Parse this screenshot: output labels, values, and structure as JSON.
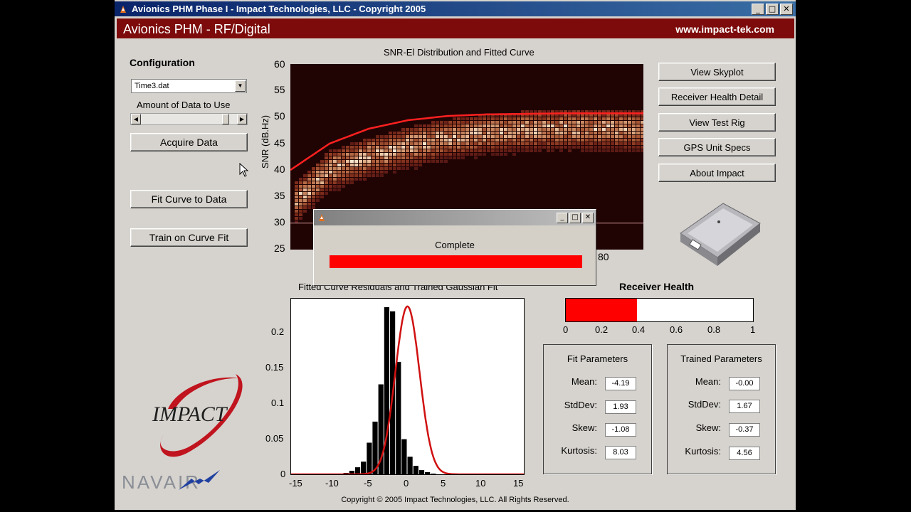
{
  "window": {
    "title": "Avionics PHM Phase I - Impact Technologies, LLC - Copyright 2005",
    "buttons": [
      "_",
      "□",
      "✕"
    ]
  },
  "banner": {
    "title": "Avionics PHM - RF/Digital",
    "url": "www.impact-tek.com"
  },
  "left_panel": {
    "config_label": "Configuration",
    "config_value": "Time3.dat",
    "amount_label": "Amount of Data to Use",
    "slider_value": 0.9,
    "acquire_label": "Acquire Data",
    "fit_label": "Fit Curve to Data",
    "train_label": "Train on Curve Fit"
  },
  "right_buttons": [
    "View Skyplot",
    "Receiver Health Detail",
    "View Test Rig",
    "GPS Unit Specs",
    "About Impact"
  ],
  "snr_chart": {
    "title": "SNR-El Distribution and Fitted Curve",
    "ylabel": "SNR (dB.Hz)",
    "yticks": [
      "60",
      "55",
      "50",
      "45",
      "40",
      "35",
      "30",
      "25"
    ],
    "xtick_visible": "80",
    "colors": {
      "background": "#200404",
      "fit": "#ff2020",
      "density": "#fff2e0"
    }
  },
  "dialog": {
    "message": "Complete",
    "progress": 1.0,
    "buttons": [
      "_",
      "□",
      "✕"
    ]
  },
  "resid_chart": {
    "title": "Fitted Curve Residuals and Trained Gaussian Fit",
    "yticks": [
      "0.2",
      "0.15",
      "0.1",
      "0.05",
      "0"
    ],
    "xticks": [
      "-15",
      "-10",
      "-5",
      "0",
      "5",
      "10",
      "15"
    ]
  },
  "chart_data": [
    {
      "type": "heatmap",
      "title": "SNR-El Distribution and Fitted Curve",
      "ylabel": "SNR (dB.Hz)",
      "ylim": [
        25,
        60
      ],
      "xlim": [
        0,
        90
      ],
      "x_tick_labels_visible": [
        "80"
      ],
      "fitted_curve": {
        "x": [
          0,
          10,
          20,
          30,
          40,
          50,
          60,
          70,
          80,
          90
        ],
        "y": [
          40,
          45,
          47.8,
          49.4,
          50.2,
          50.5,
          50.6,
          50.7,
          50.7,
          50.7
        ]
      },
      "density_band_center": {
        "x": [
          0,
          10,
          20,
          30,
          40,
          50,
          60,
          70,
          80,
          90
        ],
        "y": [
          33,
          40,
          42.5,
          44.5,
          46,
          47,
          47.5,
          47.8,
          47.8,
          47.6
        ]
      },
      "colors": {
        "fit": "#ff2020",
        "high_density": "#fff2e0",
        "background": "#200404"
      }
    },
    {
      "type": "bar",
      "title": "Fitted Curve Residuals and Trained Gaussian Fit",
      "xlim": [
        -16,
        16
      ],
      "ylim": [
        0,
        0.25
      ],
      "bin_width": 0.8,
      "bins": [
        -8.8,
        -8,
        -7.2,
        -6.4,
        -5.6,
        -4.8,
        -4,
        -3.2,
        -2.4,
        -1.6,
        -0.8,
        0,
        0.8,
        1.6,
        2.4,
        3.2
      ],
      "values": [
        0.002,
        0.005,
        0.01,
        0.018,
        0.045,
        0.075,
        0.128,
        0.238,
        0.232,
        0.16,
        0.05,
        0.025,
        0.012,
        0.006,
        0.003,
        0.001
      ],
      "gaussian": {
        "mean": 0.0,
        "std": 1.67,
        "peak": 0.239,
        "color": "#d01010"
      },
      "bar_color": "#000000"
    },
    {
      "type": "bar",
      "title": "Receiver Health",
      "value": 0.38,
      "xlim": [
        0,
        1
      ],
      "xticks": [
        "0",
        "0.2",
        "0.4",
        "0.6",
        "0.8",
        "1"
      ]
    }
  ],
  "health": {
    "title": "Receiver Health",
    "value": 0.38,
    "xticks": [
      "0",
      "0.2",
      "0.4",
      "0.6",
      "0.8",
      "1"
    ]
  },
  "fit_params": {
    "title": "Fit Parameters",
    "rows": [
      {
        "label": "Mean:",
        "value": "-4.19"
      },
      {
        "label": "StdDev:",
        "value": "1.93"
      },
      {
        "label": "Skew:",
        "value": "-1.08"
      },
      {
        "label": "Kurtosis:",
        "value": "8.03"
      }
    ]
  },
  "trained_params": {
    "title": "Trained Parameters",
    "rows": [
      {
        "label": "Mean:",
        "value": "-0.00"
      },
      {
        "label": "StdDev:",
        "value": "1.67"
      },
      {
        "label": "Skew:",
        "value": "-0.37"
      },
      {
        "label": "Kurtosis:",
        "value": "4.56"
      }
    ]
  },
  "logos": {
    "company": "IMPACT",
    "navair": "NAVAIR"
  },
  "footer": "Copyright © 2005 Impact Technologies, LLC. All Rights Reserved."
}
